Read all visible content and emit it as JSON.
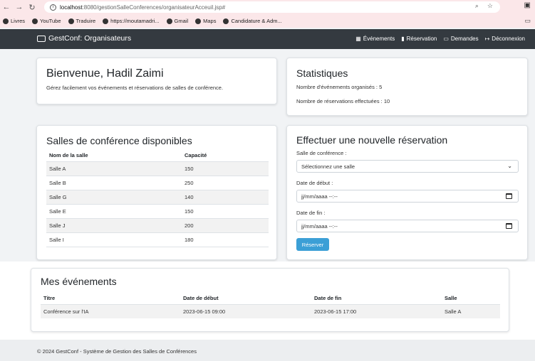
{
  "browser": {
    "url_host": "localhost",
    "url_path": ":8080/gestionSalleConferences/organisateurAcceuil.jsp#",
    "bookmarks": [
      "Livres",
      "YouTube",
      "Traduire",
      "https://moutamadri...",
      "Gmail",
      "Maps",
      "Candidature & Adm..."
    ]
  },
  "navbar": {
    "brand": "GestConf: Organisateurs",
    "links": [
      "Événements",
      "Réservation",
      "Demandes",
      "Déconnexion"
    ]
  },
  "welcome": {
    "title": "Bienvenue, Hadil Zaimi",
    "subtitle": "Gérez facilement vos événements et réservations de salles de conférence."
  },
  "stats": {
    "title": "Statistiques",
    "events_line": "Nombre d'événements organisés : 5",
    "reservations_line": "Nombre de réservations effectuées : 10"
  },
  "rooms": {
    "title": "Salles de conférence disponibles",
    "headers": [
      "Nom de la salle",
      "Capacité"
    ],
    "rows": [
      [
        "Salle A",
        "150"
      ],
      [
        "Salle B",
        "250"
      ],
      [
        "Salle G",
        "140"
      ],
      [
        "Salle E",
        "150"
      ],
      [
        "Salle J",
        "200"
      ],
      [
        "Salle I",
        "180"
      ]
    ]
  },
  "booking": {
    "title": "Effectuer une nouvelle réservation",
    "room_label": "Salle de conférence :",
    "room_select": "Sélectionnez une salle",
    "start_label": "Date de début :",
    "start_placeholder": "jj/mm/aaaa --:--",
    "end_label": "Date de fin :",
    "end_placeholder": "jj/mm/aaaa --:--",
    "submit": "Réserver"
  },
  "events": {
    "title": "Mes événements",
    "headers": [
      "Titre",
      "Date de début",
      "Date de fin",
      "Salle"
    ],
    "rows": [
      [
        "Conférence sur l'IA",
        "2023-06-15 09:00",
        "2023-06-15 17:00",
        "Salle A"
      ]
    ]
  },
  "footer": {
    "text": "© 2024 GestConf - Système de Gestion des Salles de Conférences"
  }
}
